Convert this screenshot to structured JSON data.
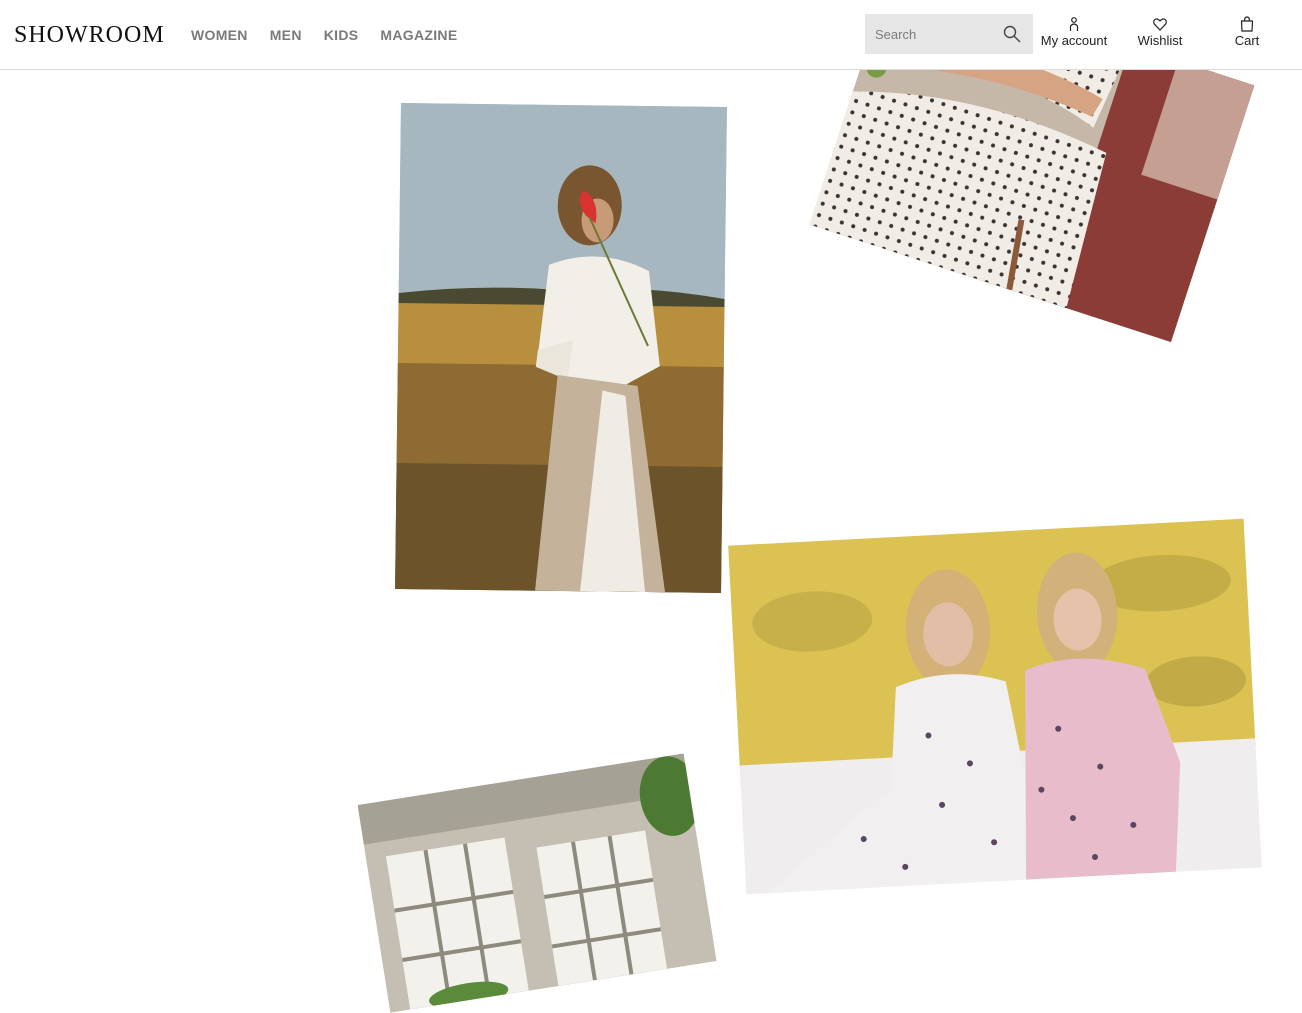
{
  "brand": {
    "logo_text": "SHOWROOM"
  },
  "nav": {
    "items": [
      {
        "label": "WOMEN"
      },
      {
        "label": "MEN"
      },
      {
        "label": "KIDS"
      },
      {
        "label": "MAGAZINE"
      }
    ]
  },
  "search": {
    "placeholder": "Search",
    "value": "",
    "icon": "search-icon"
  },
  "tools": {
    "account": {
      "label": "My account",
      "icon": "person-icon"
    },
    "wishlist": {
      "label": "Wishlist",
      "icon": "heart-icon"
    },
    "cart": {
      "label": "Cart",
      "icon": "bag-icon"
    }
  },
  "gallery": {
    "photos": [
      {
        "subject": "woman-in-field-photo"
      },
      {
        "subject": "polka-dot-dress-photo"
      },
      {
        "subject": "two-women-floral-dresses-photo"
      },
      {
        "subject": "window-interior-photo"
      }
    ]
  },
  "colors": {
    "nav_text": "#7a7a7a",
    "search_bg": "#e6e6e6",
    "text": "#222222"
  }
}
